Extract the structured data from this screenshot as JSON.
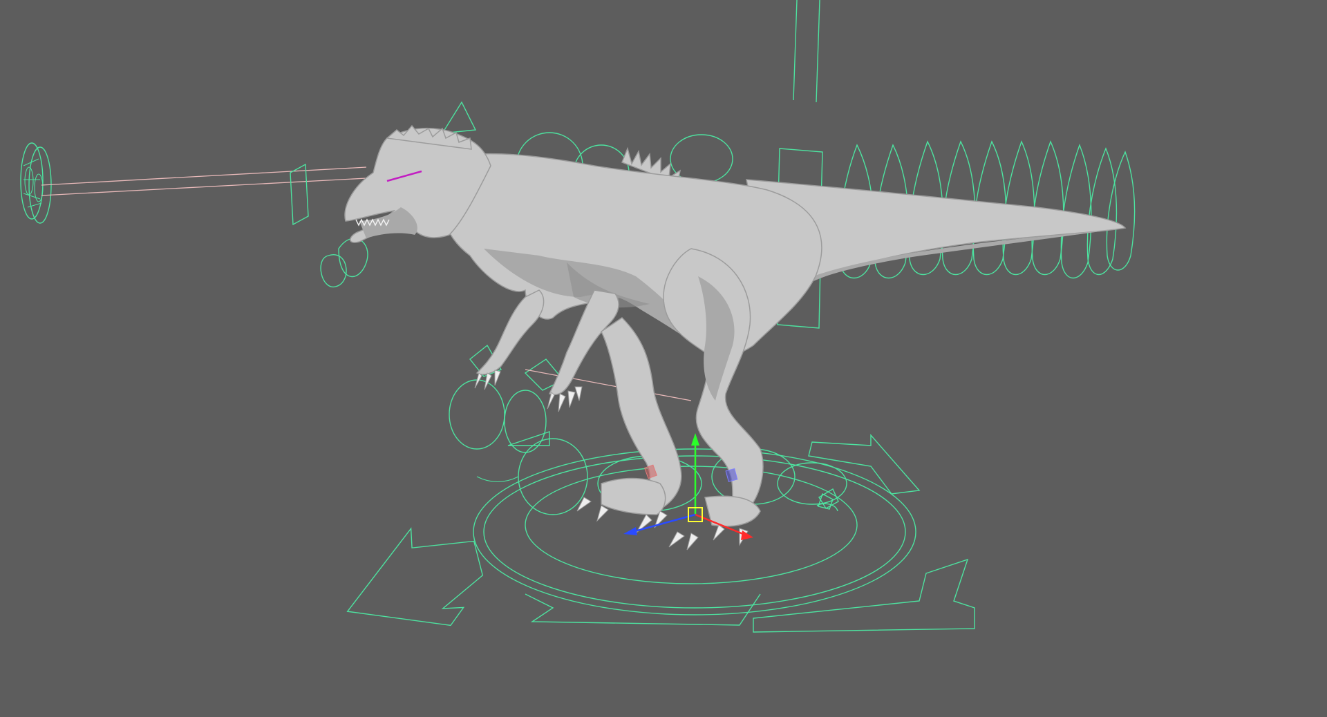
{
  "viewport": {
    "background": "#5d5d5d",
    "control_color": "#4de3a0",
    "aim_line_color": "#e8b9b9"
  },
  "scene": {
    "subject": "dinosaur-character-rig",
    "icons": [
      "move-manipulator-icon",
      "eye-aim-control-icon",
      "cog-control-icon"
    ]
  },
  "manipulator": {
    "x_axis_color": "#ff2a2a",
    "y_axis_color": "#2aff2a",
    "z_axis_color": "#2a4bff",
    "center_color": "#ffff33"
  }
}
